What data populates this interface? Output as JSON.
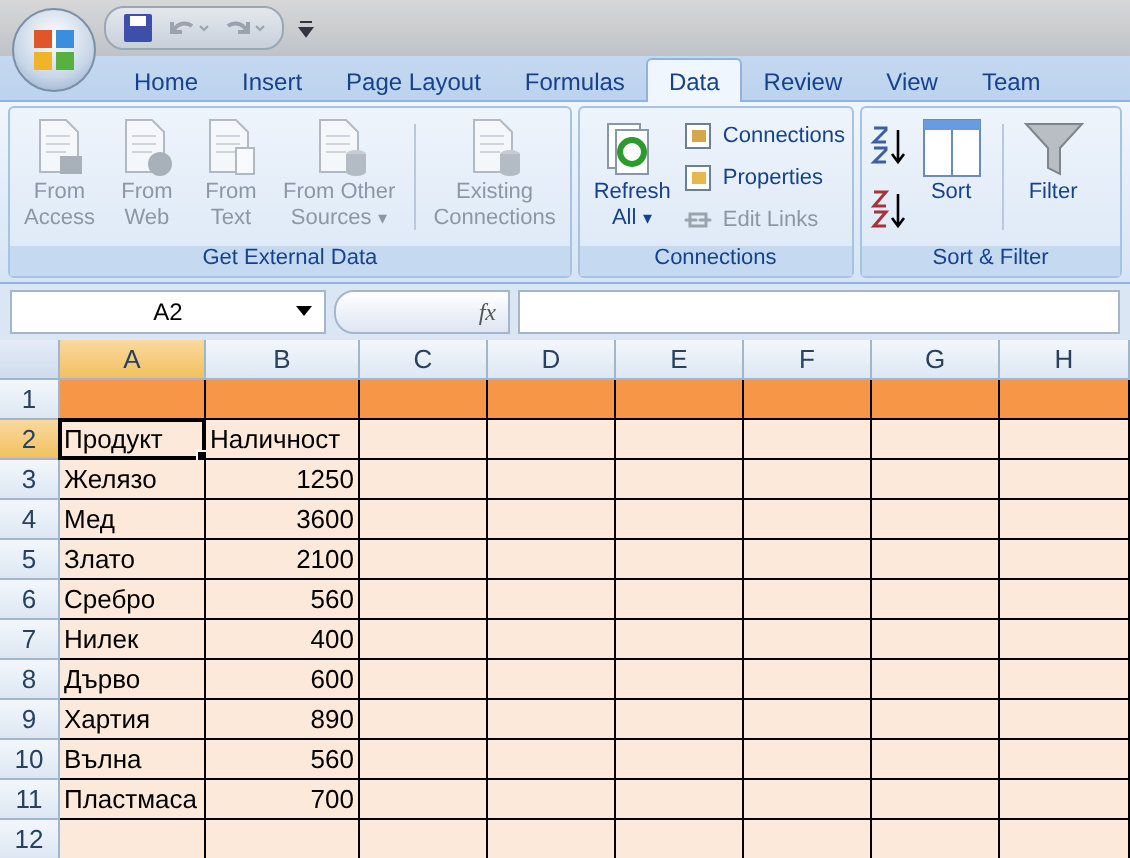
{
  "tabs": [
    {
      "label": "Home",
      "selected": false
    },
    {
      "label": "Insert",
      "selected": false
    },
    {
      "label": "Page Layout",
      "selected": false
    },
    {
      "label": "Formulas",
      "selected": false
    },
    {
      "label": "Data",
      "selected": true
    },
    {
      "label": "Review",
      "selected": false
    },
    {
      "label": "View",
      "selected": false
    },
    {
      "label": "Team",
      "selected": false
    }
  ],
  "groups": [
    {
      "title": "Get External Data",
      "items": [
        {
          "kind": "large",
          "label": "From\nAccess",
          "disabled": true
        },
        {
          "kind": "large",
          "label": "From\nWeb",
          "disabled": true
        },
        {
          "kind": "large",
          "label": "From\nText",
          "disabled": true
        },
        {
          "kind": "large",
          "label": "From Other\nSources",
          "disabled": true,
          "arrow": "▾"
        },
        {
          "kind": "separator"
        },
        {
          "kind": "large",
          "label": "Existing\nConnections",
          "disabled": true
        }
      ]
    },
    {
      "title": "Connections",
      "items": [
        {
          "kind": "large",
          "label": "Refresh\nAll",
          "disabled": false,
          "arrow": "▾"
        },
        {
          "kind": "stack",
          "buttons": [
            {
              "label": "Connections",
              "disabled": false
            },
            {
              "label": "Properties",
              "disabled": false
            },
            {
              "label": "Edit Links",
              "disabled": true
            }
          ]
        }
      ]
    },
    {
      "title": "Sort & Filter",
      "items": [
        {
          "kind": "sortpair"
        },
        {
          "kind": "large",
          "label": "Sort",
          "disabled": false
        },
        {
          "kind": "separator"
        },
        {
          "kind": "large",
          "label": "Filter",
          "disabled": false
        }
      ]
    }
  ],
  "name_box": "A2",
  "function_label": "fx",
  "columns": [
    {
      "label": "A",
      "selected": true
    },
    {
      "label": "B",
      "selected": false
    },
    {
      "label": "C",
      "selected": false
    },
    {
      "label": "D",
      "selected": false
    },
    {
      "label": "E",
      "selected": false
    },
    {
      "label": "F",
      "selected": false
    },
    {
      "label": "G",
      "selected": false
    },
    {
      "label": "H",
      "selected": false
    }
  ],
  "rows": [
    {
      "header": "1",
      "selected": false,
      "color": "#f79646"
    },
    {
      "header": "2",
      "selected": true,
      "color": "#fde9d9",
      "cells": [
        {
          "text": "Продукт",
          "kind": "text",
          "selected": true
        },
        {
          "text": "Наличност",
          "kind": "text",
          "selected": false
        }
      ]
    },
    {
      "header": "3",
      "selected": false,
      "color": "#fde9d9",
      "cells": [
        {
          "text": "Желязо",
          "kind": "text",
          "selected": false
        },
        {
          "text": "1250",
          "kind": "number",
          "selected": false
        }
      ]
    },
    {
      "header": "4",
      "selected": false,
      "color": "#fde9d9",
      "cells": [
        {
          "text": "Мед",
          "kind": "text",
          "selected": false
        },
        {
          "text": "3600",
          "kind": "number",
          "selected": false
        }
      ]
    },
    {
      "header": "5",
      "selected": false,
      "color": "#fde9d9",
      "cells": [
        {
          "text": "Злато",
          "kind": "text",
          "selected": false
        },
        {
          "text": "2100",
          "kind": "number",
          "selected": false
        }
      ]
    },
    {
      "header": "6",
      "selected": false,
      "color": "#fde9d9",
      "cells": [
        {
          "text": "Сребро",
          "kind": "text",
          "selected": false
        },
        {
          "text": "560",
          "kind": "number",
          "selected": false
        }
      ]
    },
    {
      "header": "7",
      "selected": false,
      "color": "#fde9d9",
      "cells": [
        {
          "text": "Нилек",
          "kind": "text",
          "selected": false
        },
        {
          "text": "400",
          "kind": "number",
          "selected": false
        }
      ]
    },
    {
      "header": "8",
      "selected": false,
      "color": "#fde9d9",
      "cells": [
        {
          "text": "Дърво",
          "kind": "text",
          "selected": false
        },
        {
          "text": "600",
          "kind": "number",
          "selected": false
        }
      ]
    },
    {
      "header": "9",
      "selected": false,
      "color": "#fde9d9",
      "cells": [
        {
          "text": "Хартия",
          "kind": "text",
          "selected": false
        },
        {
          "text": "890",
          "kind": "number",
          "selected": false
        }
      ]
    },
    {
      "header": "10",
      "selected": false,
      "color": "#fde9d9",
      "cells": [
        {
          "text": "Вълна",
          "kind": "text",
          "selected": false
        },
        {
          "text": "560",
          "kind": "number",
          "selected": false
        }
      ]
    },
    {
      "header": "11",
      "selected": false,
      "color": "#fde9d9",
      "cells": [
        {
          "text": "Пластмаса",
          "kind": "text",
          "selected": false
        },
        {
          "text": "700",
          "kind": "number",
          "selected": false
        }
      ]
    },
    {
      "header": "12",
      "selected": false,
      "color": "#fde9d9"
    }
  ]
}
